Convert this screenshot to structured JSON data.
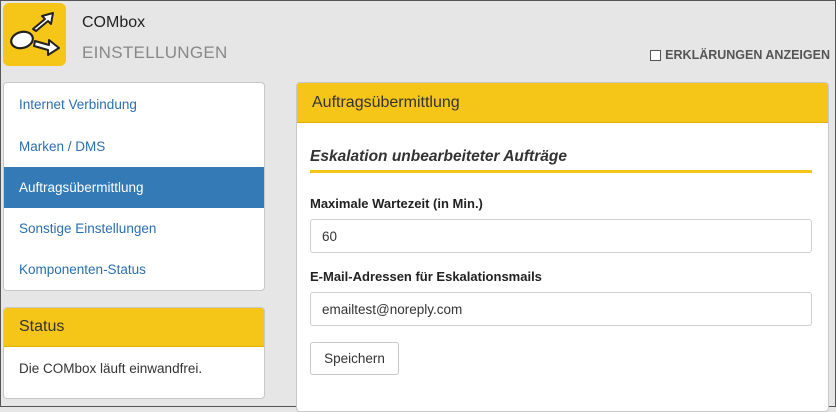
{
  "header": {
    "app_title": "COMbox",
    "app_subtitle": "EINSTELLUNGEN",
    "explain_label": "ERKLÄRUNGEN ANZEIGEN",
    "explain_checked": false
  },
  "sidebar": {
    "items": [
      {
        "label": "Internet Verbindung",
        "active": false
      },
      {
        "label": "Marken / DMS",
        "active": false
      },
      {
        "label": "Auftragsübermittlung",
        "active": true
      },
      {
        "label": "Sonstige Einstellungen",
        "active": false
      },
      {
        "label": "Komponenten-Status",
        "active": false
      }
    ]
  },
  "status": {
    "title": "Status",
    "message": "Die COMbox läuft einwandfrei."
  },
  "main": {
    "title": "Auftragsübermittlung",
    "section_title": "Eskalation unbearbeiteter Aufträge",
    "wait_label": "Maximale Wartezeit (in Min.)",
    "wait_value": "60",
    "email_label": "E-Mail-Adressen für Eskalationsmails",
    "email_value": "emailtest@noreply.com",
    "save_label": "Speichern"
  },
  "colors": {
    "accent": "#f5c518",
    "active_nav": "#337ab7",
    "link": "#2a6fb0"
  }
}
